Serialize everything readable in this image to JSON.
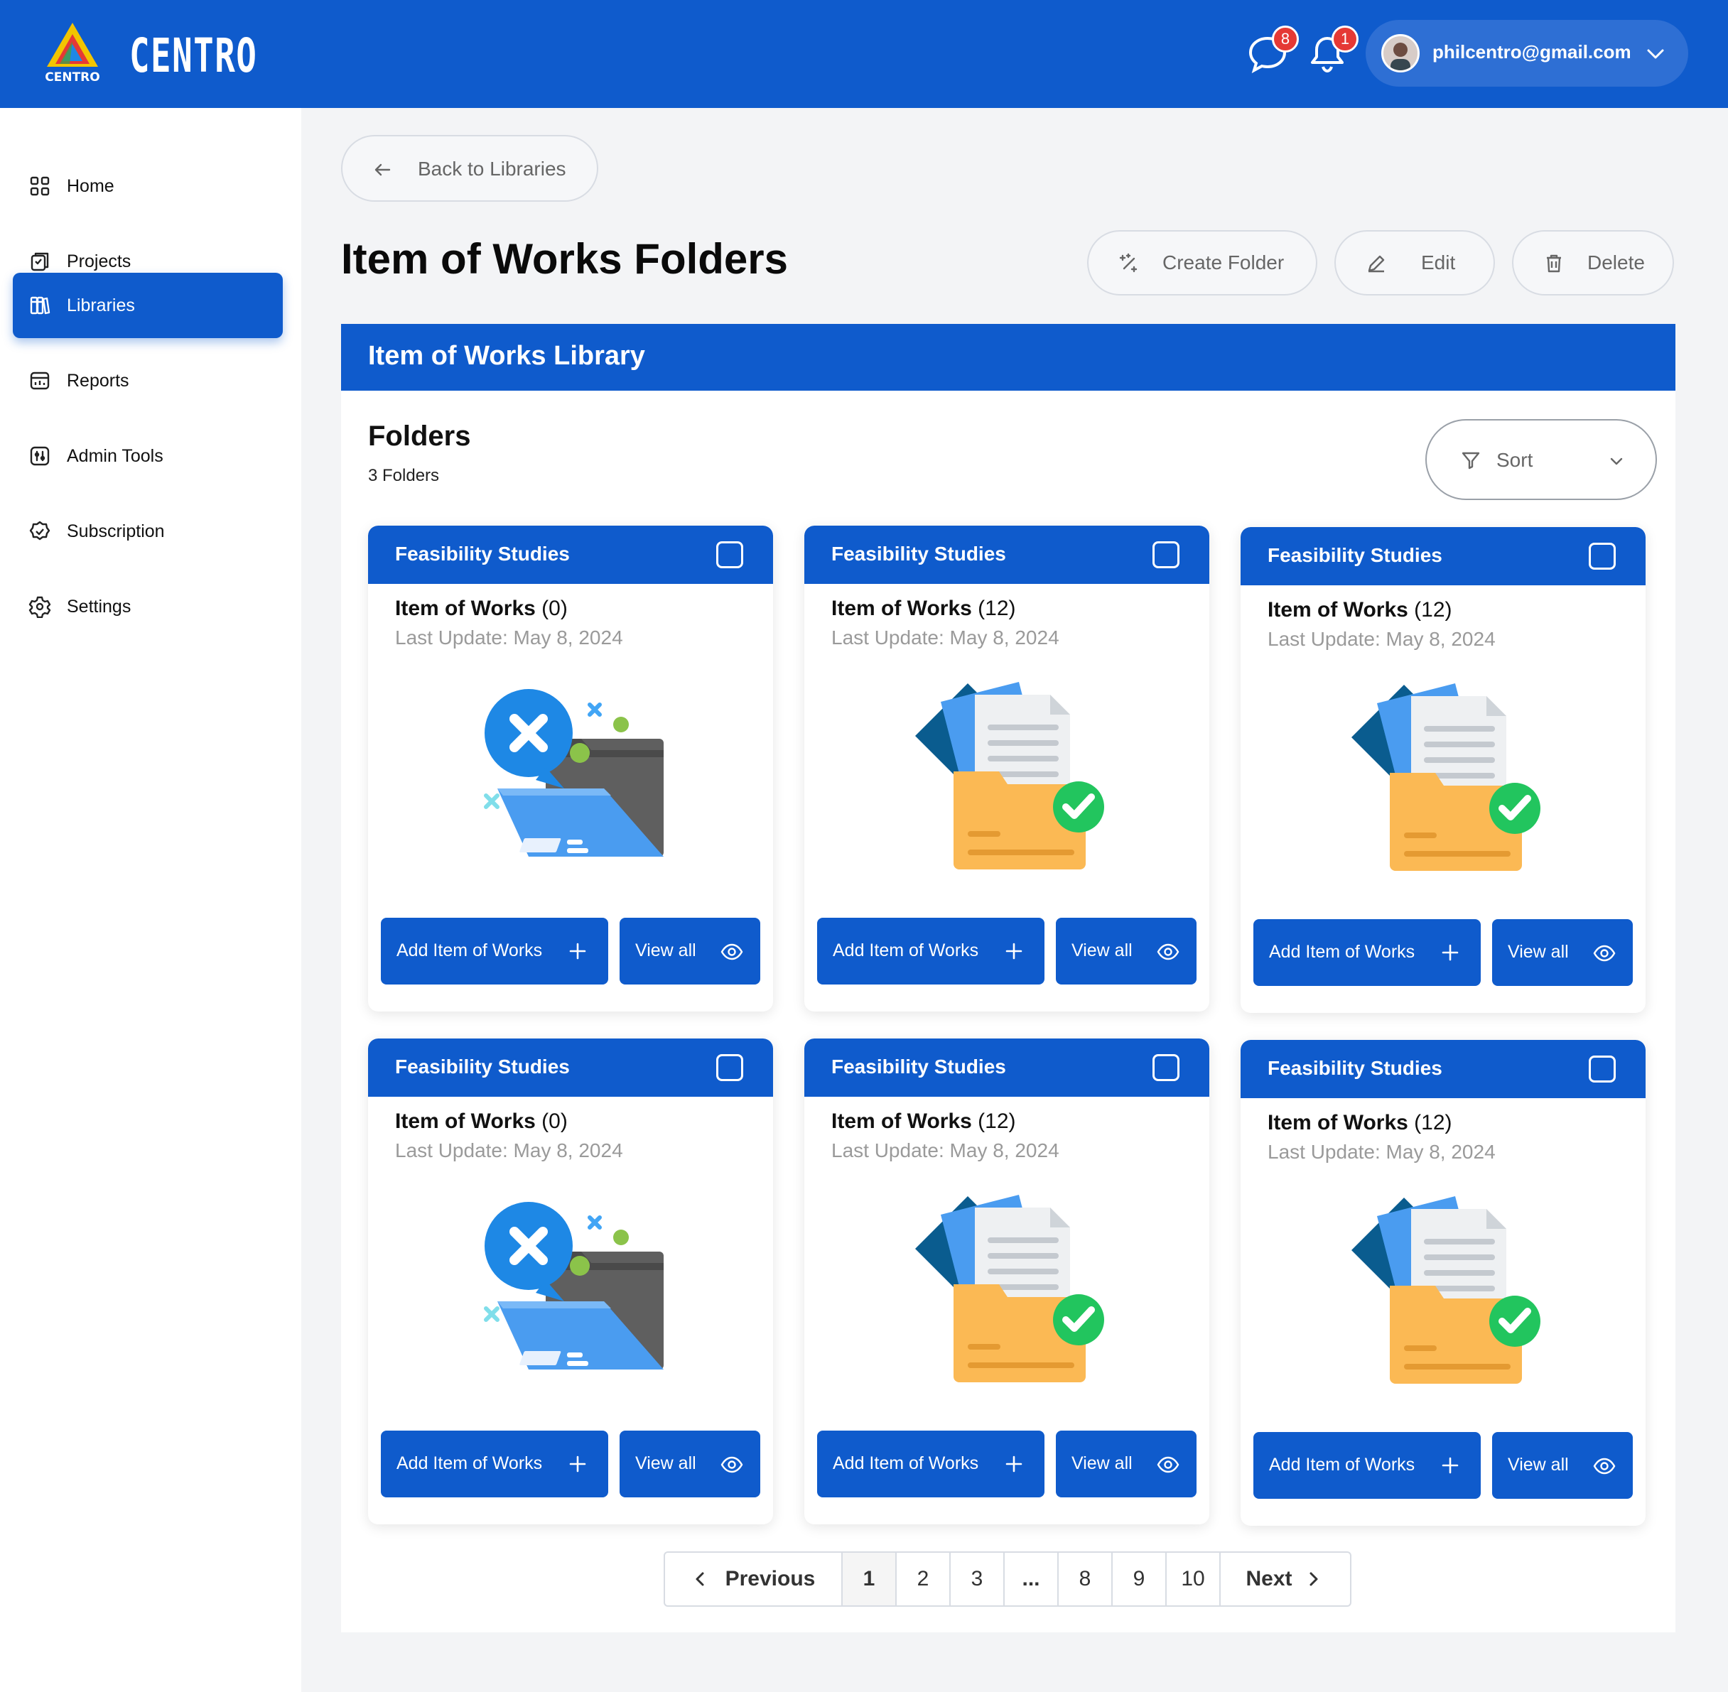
{
  "header": {
    "brand": "CENTRO",
    "logo_text": "CENTRO",
    "messages_badge": "8",
    "notifications_badge": "1",
    "user_email": "philcentro@gmail.com"
  },
  "sidebar": {
    "items": [
      {
        "label": "Home",
        "icon": "grid-icon"
      },
      {
        "label": "Projects",
        "icon": "projects-icon"
      },
      {
        "label": "Libraries",
        "icon": "books-icon",
        "active": true
      },
      {
        "label": "Reports",
        "icon": "reports-icon"
      },
      {
        "label": "Admin Tools",
        "icon": "admin-tools-icon"
      },
      {
        "label": "Subscription",
        "icon": "badge-check-icon"
      },
      {
        "label": "Settings",
        "icon": "gear-icon"
      }
    ]
  },
  "main": {
    "back_label": "Back to Libraries",
    "title": "Item of Works Folders",
    "actions": {
      "create": "Create Folder",
      "edit": "Edit",
      "delete": "Delete"
    },
    "panel_title": "Item of Works Library",
    "folders_title": "Folders",
    "folders_count": "3 Folders",
    "sort_label": "Sort"
  },
  "cards": [
    {
      "category": "Feasibility Studies",
      "name": "Item of Works",
      "count": "(0)",
      "update": "Last Update: May 8, 2024",
      "empty": true,
      "add": "Add Item of Works",
      "view": "View all"
    },
    {
      "category": "Feasibility Studies",
      "name": "Item of Works",
      "count": "(12)",
      "update": "Last Update: May 8, 2024",
      "empty": false,
      "add": "Add Item of Works",
      "view": "View all"
    },
    {
      "category": "Feasibility Studies",
      "name": "Item of Works",
      "count": "(12)",
      "update": "Last Update: May 8, 2024",
      "empty": false,
      "add": "Add Item of Works",
      "view": "View all"
    },
    {
      "category": "Feasibility Studies",
      "name": "Item of Works",
      "count": "(0)",
      "update": "Last Update: May 8, 2024",
      "empty": true,
      "add": "Add Item of Works",
      "view": "View all"
    },
    {
      "category": "Feasibility Studies",
      "name": "Item of Works",
      "count": "(12)",
      "update": "Last Update: May 8, 2024",
      "empty": false,
      "add": "Add Item of Works",
      "view": "View all"
    },
    {
      "category": "Feasibility Studies",
      "name": "Item of Works",
      "count": "(12)",
      "update": "Last Update: May 8, 2024",
      "empty": false,
      "add": "Add Item of Works",
      "view": "View all"
    }
  ],
  "pagination": {
    "previous": "Previous",
    "next": "Next",
    "pages": [
      "1",
      "2",
      "3",
      "...",
      "8",
      "9",
      "10"
    ],
    "current": "1"
  },
  "colors": {
    "primary": "#0f5bcc",
    "badge": "#e53935",
    "folder": "#fbb954",
    "check": "#22c55e"
  }
}
